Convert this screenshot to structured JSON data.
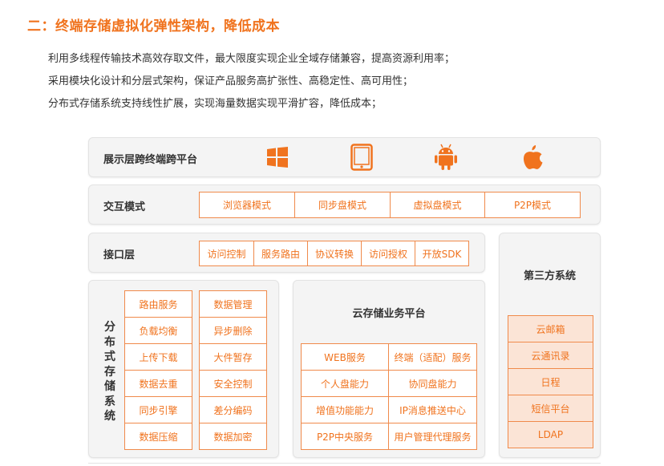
{
  "heading": "二：终端存储虚拟化弹性架构，降低成本",
  "paragraphs": [
    "利用多线程传输技术高效存取文件，最大限度实现企业全域存储兼容，提高资源利用率；",
    "采用模块化设计和分层式架构，保证产品服务高扩张性、高稳定性、高可用性；",
    "分布式存储系统支持线性扩展，实现海量数据实现平滑扩容，降低成本；"
  ],
  "display_layer": {
    "label": "展示层跨终端跨平台",
    "icons": [
      "windows-icon",
      "tablet-icon",
      "android-icon",
      "apple-icon"
    ]
  },
  "interaction": {
    "label": "交互模式",
    "items": [
      "浏览器模式",
      "同步盘模式",
      "虚拟盘模式",
      "P2P模式"
    ]
  },
  "interface": {
    "label": "接口层",
    "items": [
      "访问控制",
      "服务路由",
      "协议转换",
      "访问授权",
      "开放SDK"
    ]
  },
  "distributed": {
    "label_chars": [
      "分",
      "布",
      "式",
      "存",
      "储",
      "系",
      "统"
    ],
    "col1": [
      "路由服务",
      "负载均衡",
      "上传下载",
      "数据去重",
      "同步引擎",
      "数据压缩"
    ],
    "col2": [
      "数据管理",
      "异步删除",
      "大件暂存",
      "安全控制",
      "差分编码",
      "数据加密"
    ]
  },
  "cloud": {
    "label": "云存储业务平台",
    "col1": [
      "WEB服务",
      "个人盘能力",
      "增值功能能力",
      "P2P中央服务"
    ],
    "col2": [
      "终端（适配）服务",
      "协同盘能力",
      "IP消息推送中心",
      "用户管理代理服务"
    ]
  },
  "third_party": {
    "label": "第三方系统",
    "items": [
      "云邮箱",
      "云通讯录",
      "日程",
      "短信平台",
      "LDAP"
    ]
  },
  "colors": {
    "accent": "#f0731e",
    "fill": "#fbe4d6",
    "panel": "#f4f4f4"
  }
}
